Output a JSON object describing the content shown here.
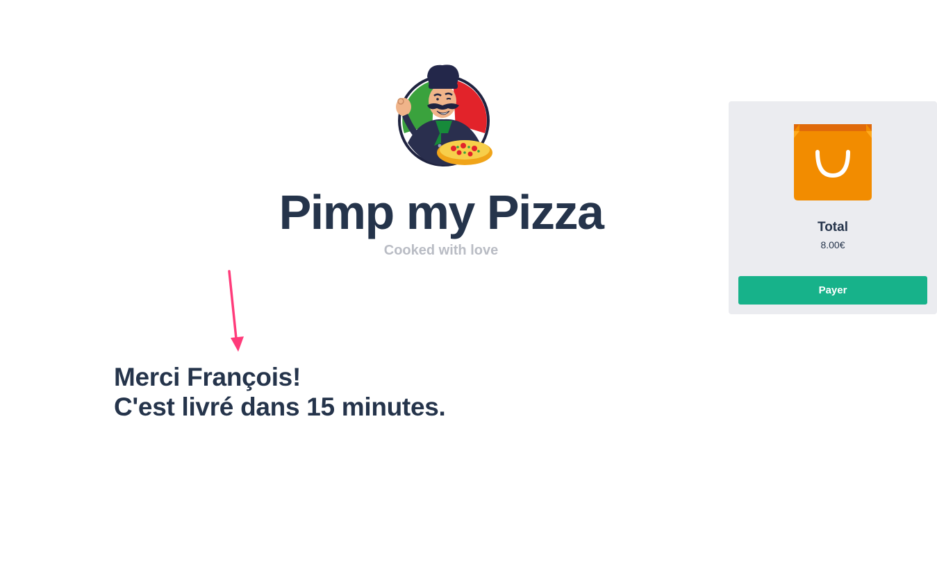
{
  "brand": {
    "title": "Pimp my Pizza",
    "tagline": "Cooked with love",
    "logo_icon": "pizza-chef-logo"
  },
  "confirmation": {
    "line1": "Merci François!",
    "line2": "C'est livré dans 15 minutes."
  },
  "annotation": {
    "icon": "arrow-down-icon",
    "color": "#ff3b7a"
  },
  "cart": {
    "icon": "shopping-bag-icon",
    "total_label": "Total",
    "total_value": "8.00€",
    "pay_label": "Payer"
  },
  "colors": {
    "text": "#25344b",
    "tagline": "#b9bcc4",
    "panel_bg": "#ebecf0",
    "pay_button": "#17b28a",
    "bag_orange": "#f28c00",
    "bag_dark_orange": "#e06a0a"
  }
}
